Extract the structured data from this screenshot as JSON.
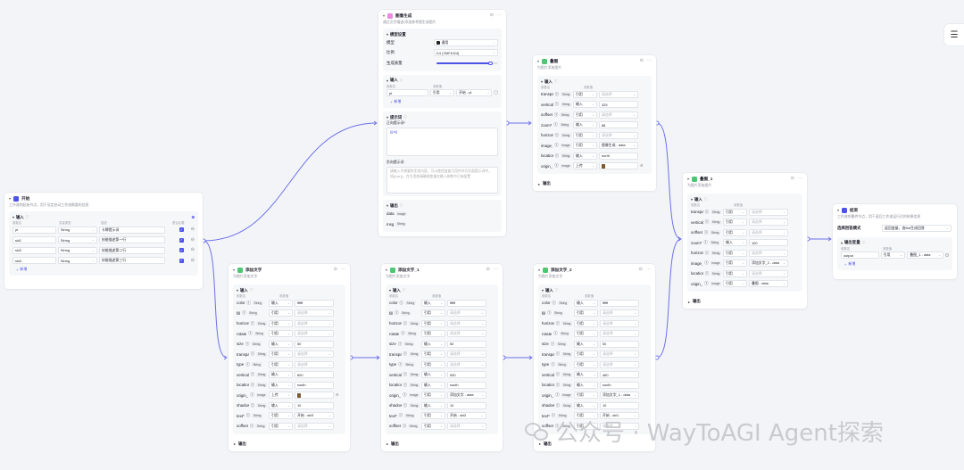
{
  "colors": {
    "accent": "#4d53e8",
    "start": "#4d53e8",
    "image": "#e88ae6",
    "process": "#4dc772",
    "end": "#4d53e8"
  },
  "panel_icon": "list-collapse-icon",
  "watermark": {
    "text": "公众号 · WayToAGI Agent探索",
    "icon": "wechat-icon"
  },
  "common": {
    "input": "输入",
    "output": "输出",
    "add": "新增",
    "ref": "引用",
    "val": "输入",
    "select": "请选择",
    "pname": "参数名",
    "pvalue": "参数值",
    "ptype": "变量类型",
    "pdesc": "描述",
    "required": "是否必要"
  },
  "start": {
    "title": "开始",
    "desc": "工作流的起始节点，用于设定启动工作流需要的信息",
    "rows": [
      {
        "name": "pt",
        "type": "String",
        "desc": "卡牌提示词"
      },
      {
        "name": "ski1",
        "type": "String",
        "desc": "技能描述第一行"
      },
      {
        "name": "ski2",
        "type": "String",
        "desc": "技能描述第二行"
      },
      {
        "name": "ski3",
        "type": "String",
        "desc": "技能描述第三行"
      }
    ]
  },
  "imggen": {
    "title": "图像生成",
    "desc": "通过文字描述/添加参考图生成图片",
    "model_section": "模型设置",
    "model_label": "模型",
    "model_value": "通用",
    "ratio_label": "比例",
    "ratio_value": "3:4 (768*1024)",
    "quality_label": "生成质量",
    "quality": 0.88,
    "input_row": {
      "name": "pt",
      "mode": "引用",
      "value": "开始 - pt"
    },
    "prompt_section": "提示词",
    "pos_label": "正向提示词*",
    "pos_value": "{{pt}}",
    "neg_label": "负向提示词",
    "neg_placeholder": "请输入不想要的生成内容，可以使用变量引用并作为负面提示词中，如{{var}}，在引用前请确保变量在输入参数中已有配置",
    "outputs": [
      {
        "name": "data",
        "type": "Image"
      },
      {
        "name": "msg",
        "type": "String"
      }
    ]
  },
  "text1": {
    "title": "添加文字",
    "desc": "为图片添加文字",
    "rows": [
      {
        "name": "color",
        "type": "String",
        "mode": "输入",
        "value": "ffffff"
      },
      {
        "name": "fill",
        "type": "String",
        "mode": "引用",
        "value": "请选择",
        "ph": true
      },
      {
        "name": "horizontal...",
        "type": "String",
        "mode": "引用",
        "value": "请选择",
        "ph": true
      },
      {
        "name": "rotate",
        "type": "String",
        "mode": "引用",
        "value": "请选择",
        "ph": true
      },
      {
        "name": "size",
        "type": "String",
        "mode": "输入",
        "value": "50"
      },
      {
        "name": "transparen...",
        "type": "String",
        "mode": "引用",
        "value": "请选择",
        "ph": true
      },
      {
        "name": "type",
        "type": "String",
        "mode": "引用",
        "value": "请选择",
        "ph": true
      },
      {
        "name": "vertical_m...",
        "type": "String",
        "mode": "输入",
        "value": "600"
      },
      {
        "name": "location",
        "type": "String",
        "mode": "输入",
        "value": "south"
      },
      {
        "name": "origin_url*",
        "type": "Image",
        "mode": "上传",
        "value": "",
        "img": true
      },
      {
        "name": "shadow",
        "type": "String",
        "mode": "输入",
        "value": "10"
      },
      {
        "name": "text*",
        "type": "String",
        "mode": "引用",
        "value": "开始 - ski3"
      },
      {
        "name": "xoffset",
        "type": "String",
        "mode": "引用",
        "value": "请选择",
        "ph": true
      }
    ]
  },
  "text2": {
    "title": "添加文字_1",
    "desc": "为图片添加文字",
    "rows": [
      {
        "name": "color",
        "type": "String",
        "mode": "输入",
        "value": "ffffff"
      },
      {
        "name": "fill",
        "type": "String",
        "mode": "引用",
        "value": "请选择",
        "ph": true
      },
      {
        "name": "horizontal...",
        "type": "String",
        "mode": "引用",
        "value": "请选择",
        "ph": true
      },
      {
        "name": "rotate",
        "type": "String",
        "mode": "引用",
        "value": "请选择",
        "ph": true
      },
      {
        "name": "size",
        "type": "String",
        "mode": "输入",
        "value": "50"
      },
      {
        "name": "transparen...",
        "type": "String",
        "mode": "引用",
        "value": "请选择",
        "ph": true
      },
      {
        "name": "type",
        "type": "String",
        "mode": "引用",
        "value": "请选择",
        "ph": true
      },
      {
        "name": "vertical_m...",
        "type": "String",
        "mode": "输入",
        "value": "530"
      },
      {
        "name": "location",
        "type": "String",
        "mode": "输入",
        "value": "south"
      },
      {
        "name": "origin_url*",
        "type": "Image",
        "mode": "引用",
        "value": "添加文字 - data"
      },
      {
        "name": "shadow",
        "type": "String",
        "mode": "输入",
        "value": "10"
      },
      {
        "name": "text*",
        "type": "String",
        "mode": "引用",
        "value": "开始 - ski2"
      },
      {
        "name": "xoffset",
        "type": "String",
        "mode": "引用",
        "value": "请选择",
        "ph": true
      }
    ]
  },
  "text3": {
    "title": "添加文字_2",
    "desc": "为图片添加文字",
    "rows": [
      {
        "name": "color",
        "type": "String",
        "mode": "输入",
        "value": "ffffff"
      },
      {
        "name": "fill",
        "type": "String",
        "mode": "引用",
        "value": "请选择",
        "ph": true
      },
      {
        "name": "horizontal...",
        "type": "String",
        "mode": "引用",
        "value": "请选择",
        "ph": true
      },
      {
        "name": "rotate",
        "type": "String",
        "mode": "引用",
        "value": "请选择",
        "ph": true
      },
      {
        "name": "size",
        "type": "String",
        "mode": "输入",
        "value": "50"
      },
      {
        "name": "transparen...",
        "type": "String",
        "mode": "引用",
        "value": "请选择",
        "ph": true
      },
      {
        "name": "type",
        "type": "String",
        "mode": "引用",
        "value": "请选择",
        "ph": true
      },
      {
        "name": "vertical_m...",
        "type": "String",
        "mode": "输入",
        "value": "460"
      },
      {
        "name": "location",
        "type": "String",
        "mode": "输入",
        "value": "south"
      },
      {
        "name": "origin_url*",
        "type": "Image",
        "mode": "引用",
        "value": "添加文字_1 - data"
      },
      {
        "name": "shadow",
        "type": "String",
        "mode": "输入",
        "value": "10"
      },
      {
        "name": "text*",
        "type": "String",
        "mode": "引用",
        "value": "开始 - ski1"
      },
      {
        "name": "xoffset",
        "type": "String",
        "mode": "引用",
        "value": "请选择",
        "ph": true
      }
    ]
  },
  "overlay": {
    "title": "叠图",
    "desc": "为图片添加图片",
    "rows": [
      {
        "name": "transparen...",
        "type": "String",
        "mode": "引用",
        "value": "请选择",
        "ph": true
      },
      {
        "name": "vertical_m...",
        "type": "String",
        "mode": "输入",
        "value": "325"
      },
      {
        "name": "xoffset",
        "type": "String",
        "mode": "引用",
        "value": "请选择",
        "ph": true
      },
      {
        "name": "zoom*",
        "type": "String",
        "mode": "输入",
        "value": "88"
      },
      {
        "name": "horizontal...",
        "type": "String",
        "mode": "引用",
        "value": "请选择",
        "ph": true
      },
      {
        "name": "image_url*",
        "type": "Image",
        "mode": "引用",
        "value": "图像生成 - data"
      },
      {
        "name": "location",
        "type": "String",
        "mode": "输入",
        "value": "north"
      },
      {
        "name": "origin_url*",
        "type": "Image",
        "mode": "上传",
        "value": "",
        "img": true
      }
    ]
  },
  "overlay1": {
    "title": "叠图_1",
    "desc": "为图片添加图片",
    "rows": [
      {
        "name": "transparen...",
        "type": "String",
        "mode": "引用",
        "value": "请选择",
        "ph": true
      },
      {
        "name": "vertical_m...",
        "type": "String",
        "mode": "引用",
        "value": "请选择",
        "ph": true
      },
      {
        "name": "xoffset",
        "type": "String",
        "mode": "引用",
        "value": "请选择",
        "ph": true
      },
      {
        "name": "zoom*",
        "type": "String",
        "mode": "输入",
        "value": "100"
      },
      {
        "name": "horizontal...",
        "type": "String",
        "mode": "引用",
        "value": "请选择",
        "ph": true
      },
      {
        "name": "image_url*",
        "type": "Image",
        "mode": "引用",
        "value": "添加文字_2 - data"
      },
      {
        "name": "location",
        "type": "String",
        "mode": "引用",
        "value": "请选择",
        "ph": true
      },
      {
        "name": "origin_url*",
        "type": "Image",
        "mode": "引用",
        "value": "叠图 - data"
      }
    ]
  },
  "end": {
    "title": "结束",
    "desc": "工作流的最终节点，用于返回工作流运行后的结果信息",
    "mode_label": "选择回答模式",
    "mode_value": "返回变量，由Bot生成回答",
    "out_section": "输出变量",
    "var_name": "output",
    "var_mode": "引用",
    "var_value": "叠图_1 - data"
  }
}
